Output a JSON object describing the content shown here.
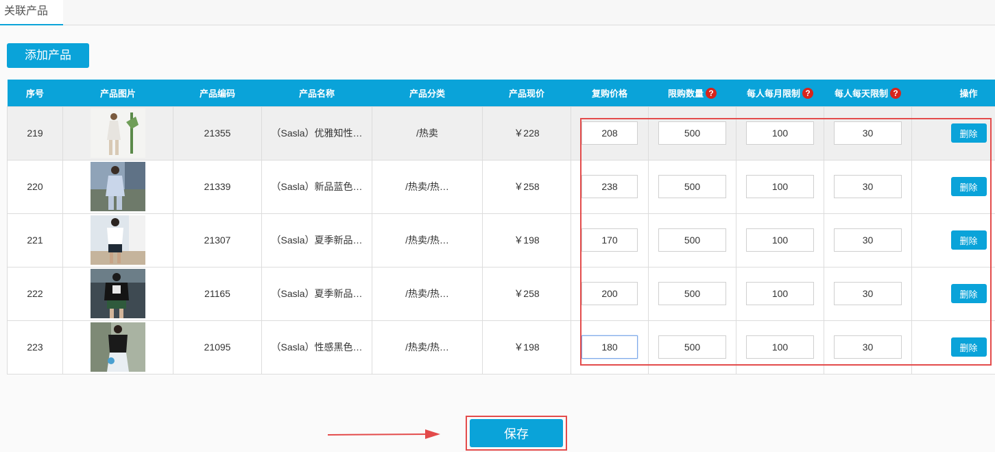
{
  "tab": {
    "label": "关联产品"
  },
  "add_button": {
    "label": "添加产品"
  },
  "save_button": {
    "label": "保存"
  },
  "colors": {
    "accent": "#0aa3d9",
    "highlight": "#e34a4a",
    "help": "#d8241c"
  },
  "table": {
    "headers": {
      "seq": "序号",
      "image": "产品图片",
      "code": "产品编码",
      "name": "产品名称",
      "category": "产品分类",
      "price": "产品现价",
      "rebuy": "复购价格",
      "limit": "限购数量",
      "monthly": "每人每月限制",
      "daily": "每人每天限制",
      "ops": "操作"
    },
    "help_glyph": "?",
    "delete_label": "删除",
    "rows": [
      {
        "seq": "219",
        "code": "21355",
        "name": "（Sasla）优雅知性…",
        "category": "/热卖",
        "price": "￥228",
        "rebuy": "208",
        "limit": "500",
        "monthly": "100",
        "daily": "30"
      },
      {
        "seq": "220",
        "code": "21339",
        "name": "（Sasla）新品蓝色…",
        "category": "/热卖/热…",
        "price": "￥258",
        "rebuy": "238",
        "limit": "500",
        "monthly": "100",
        "daily": "30"
      },
      {
        "seq": "221",
        "code": "21307",
        "name": "（Sasla）夏季新品…",
        "category": "/热卖/热…",
        "price": "￥198",
        "rebuy": "170",
        "limit": "500",
        "monthly": "100",
        "daily": "30"
      },
      {
        "seq": "222",
        "code": "21165",
        "name": "（Sasla）夏季新品…",
        "category": "/热卖/热…",
        "price": "￥258",
        "rebuy": "200",
        "limit": "500",
        "monthly": "100",
        "daily": "30"
      },
      {
        "seq": "223",
        "code": "21095",
        "name": "（Sasla）性感黑色…",
        "category": "/热卖/热…",
        "price": "￥198",
        "rebuy": "180",
        "limit": "500",
        "monthly": "100",
        "daily": "30"
      }
    ]
  }
}
